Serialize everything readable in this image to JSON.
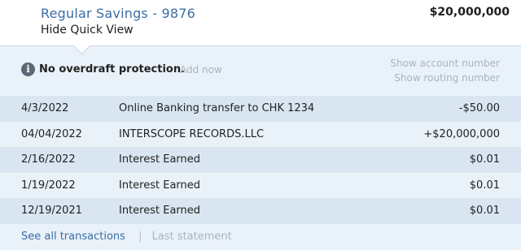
{
  "account": {
    "name": "Regular Savings - 9876",
    "balance": "$20,000,000",
    "hide_quick_view": "Hide Quick View"
  },
  "notice": {
    "icon": "info-icon",
    "icon_glyph": "i",
    "text": "No overdraft protection.",
    "action": "Add now"
  },
  "links": {
    "show_account_number": "Show account number",
    "show_routing_number": "Show routing number",
    "see_all": "See all transactions",
    "separator": "|",
    "last_statement": "Last statement"
  },
  "transactions": [
    {
      "date": "4/3/2022",
      "description": "Online Banking transfer to CHK 1234",
      "amount": "-$50.00"
    },
    {
      "date": "04/04/2022",
      "description": "INTERSCOPE RECORDS.LLC",
      "amount": "+$20,000,000"
    },
    {
      "date": "2/16/2022",
      "description": "Interest Earned",
      "amount": "$0.01"
    },
    {
      "date": "1/19/2022",
      "description": "Interest Earned",
      "amount": "$0.01"
    },
    {
      "date": "12/19/2021",
      "description": "Interest Earned",
      "amount": "$0.01"
    }
  ]
}
